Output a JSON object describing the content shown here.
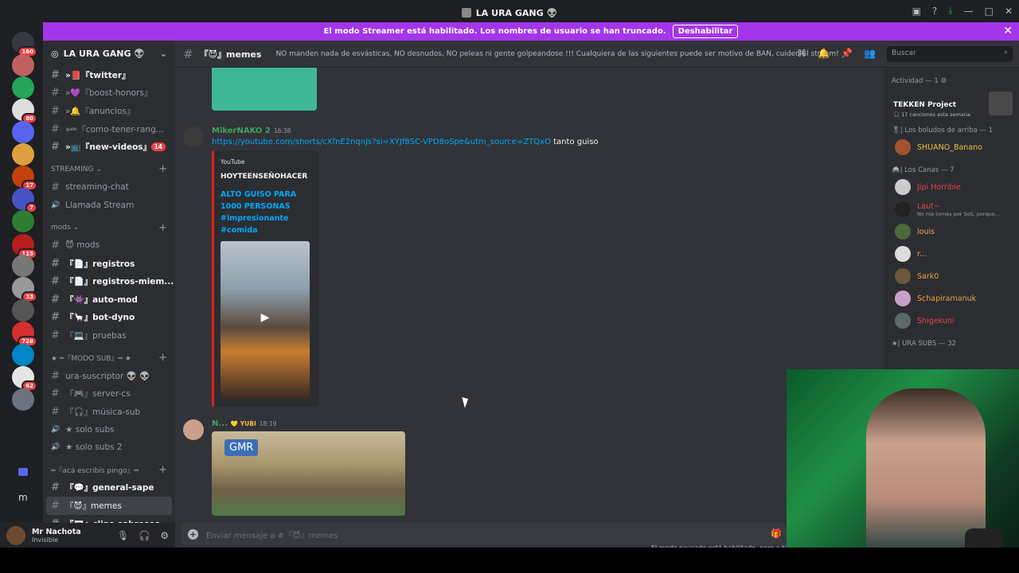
{
  "titlebar": {
    "title": "LA URA GANG 👽"
  },
  "banner": {
    "text": "El modo Streamer está habilitado. Los nombres de usuario se han truncado.",
    "button": "Deshabilitar"
  },
  "servers": [
    {
      "badge": "160",
      "color": "#36393f"
    },
    {
      "badge": "",
      "color": "#c06060"
    },
    {
      "badge": "",
      "color": "#23a55a"
    },
    {
      "badge": "80",
      "color": "#ddd"
    },
    {
      "badge": "",
      "color": "#5865f2"
    },
    {
      "badge": "",
      "color": "#e0a040"
    },
    {
      "badge": "17",
      "color": "#c2410c"
    },
    {
      "badge": "7",
      "color": "#4752c4"
    },
    {
      "badge": "",
      "color": "#2e7d32"
    },
    {
      "badge": "115",
      "color": "#b91c1c"
    },
    {
      "badge": "",
      "color": "#777"
    },
    {
      "badge": "33",
      "color": "#999"
    },
    {
      "badge": "",
      "color": "#555"
    },
    {
      "badge": "728",
      "color": "#d32f2f"
    },
    {
      "badge": "",
      "color": "#0284c7"
    },
    {
      "badge": "62",
      "color": "#e5e5e5"
    },
    {
      "badge": "",
      "color": "#6b7280"
    }
  ],
  "rail_extra": {
    "letter": "m"
  },
  "sidebar": {
    "guild_name": "LA URA GANG 👽",
    "top_channels": [
      {
        "label": "»📕『twitter』",
        "unread": true,
        "badge": ""
      },
      {
        "label": "»💜『boost-honors』",
        "unread": false,
        "badge": ""
      },
      {
        "label": "»🔔『anuncios』",
        "unread": false,
        "badge": ""
      },
      {
        "label": "»✏『como-tener-rang...",
        "unread": false,
        "badge": ""
      },
      {
        "label": "»📺『new-videos』",
        "unread": true,
        "badge": "14"
      }
    ],
    "cat_streaming": "STREAMING",
    "streaming_channels": [
      {
        "label": "streaming-chat",
        "voice": false
      },
      {
        "label": "Llamada Stream",
        "voice": true
      }
    ],
    "cat_mods": "mods",
    "mods_channels": [
      {
        "label": "😈 mods",
        "unread": false
      },
      {
        "label": "『📄』registros",
        "unread": true
      },
      {
        "label": "『📄』registros-miem...",
        "unread": true
      },
      {
        "label": "『👾』auto-mod",
        "unread": true
      },
      {
        "label": "『🦙』bot-dyno",
        "unread": true
      },
      {
        "label": "『💻』pruebas",
        "unread": false
      }
    ],
    "cat_sub": "★ ═『MODO SUB』═ ★",
    "sub_channels": [
      {
        "label": "ura-suscriptor 👽 👽",
        "voice": false
      },
      {
        "label": "『🎮』server-cs",
        "voice": false
      },
      {
        "label": "『🎧』música-sub",
        "voice": false
      },
      {
        "label": "★ solo subs",
        "voice": true
      },
      {
        "label": "★ solo subs 2",
        "voice": true
      }
    ],
    "cat_pingo": "═『acá escribís pingo』═",
    "pingo_channels": [
      {
        "label": "『💬』general-sape",
        "unread": true
      },
      {
        "label": "『😈』memes",
        "active": true
      },
      {
        "label": "『🎞』clips-sabrosos",
        "unread": true
      }
    ]
  },
  "user": {
    "name": "Mr Nachota",
    "status": "Invisible"
  },
  "header": {
    "channel": "『😈』memes",
    "topic": "NO manden nada de esvásticas, NO desnudos, NO peleas ni gente golpeandose !!! Cualquiera de las siguientes puede ser motivo de BAN, cuiden el stream!",
    "search_placeholder": "Buscar"
  },
  "messages": {
    "m1": {
      "author": "MikerNAKO 2",
      "time": "16:38",
      "link": "https://youtube.com/shorts/cXfnE2nqnJs?si=XYJf8SC-VPD8oSpe&utm_source=ZTQxO",
      "text": " tanto guiso",
      "embed": {
        "provider": "YouTube",
        "author": "HOYTEENSEÑOHACER",
        "title": "ALTO GUISO PARA 1000 PERSONAS #impresionante #comida"
      }
    },
    "m2": {
      "author": "N...",
      "tag": "💛 YUBI",
      "time": "18:19",
      "image_label": "GMR"
    }
  },
  "composer": {
    "placeholder": "Enviar mensaje a #『😈』memes",
    "pause_note": "El modo pausado está habilitado, pero a ti"
  },
  "members": {
    "activity_header": "Actividad — 1 ⚙",
    "activity": {
      "title": "TEKKEN Project",
      "sub": "🎧 17 canciones esta semana"
    },
    "groups": [
      {
        "header": "🎖| Los boludos de arriba — 1",
        "members": [
          {
            "name": "SHUANO_Banano",
            "color": "#f0c040",
            "sub": "",
            "av": "#a0522d"
          }
        ]
      },
      {
        "header": "🚔| Los Canas — 7",
        "members": [
          {
            "name": "Jipi Horrible",
            "color": "#ed4245",
            "sub": "",
            "av": "#ccc"
          },
          {
            "name": "Laut~",
            "color": "#ed4245",
            "sub": "No me tomés por SoS, porque...",
            "av": "#222"
          },
          {
            "name": "louis",
            "color": "#f0a040",
            "sub": "",
            "av": "#4a6a3a"
          },
          {
            "name": "r...",
            "color": "#f0a040",
            "sub": "",
            "av": "#ddd"
          },
          {
            "name": "Sark0",
            "color": "#f0a040",
            "sub": "",
            "av": "#6a5a3a"
          },
          {
            "name": "Schapiramanuk",
            "color": "#f0a040",
            "sub": "",
            "av": "#c8a0c8"
          },
          {
            "name": "Shigekuni",
            "color": "#ed4245",
            "sub": "",
            "av": "#5a6a6a"
          }
        ]
      },
      {
        "header": "★| URA SUBS — 32",
        "members": []
      }
    ]
  }
}
